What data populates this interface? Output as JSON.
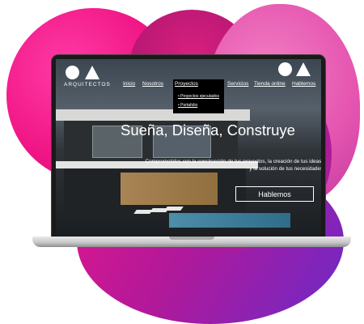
{
  "logo": {
    "text": "ARQUITECTOS",
    "icon": "oa-monogram-icon"
  },
  "nav": {
    "items": [
      {
        "label": "Inicio"
      },
      {
        "label": "Nosotros"
      },
      {
        "label": "Proyectos"
      },
      {
        "label": "Servicios"
      },
      {
        "label": "Tienda online"
      },
      {
        "label": "Hablemos"
      }
    ],
    "dropdown": [
      {
        "label": "Proyectos ejecutados"
      },
      {
        "label": "Portafolio"
      }
    ]
  },
  "hero": {
    "title": "Sueña, Diseña, Construye",
    "subtitle": "Comprometidos con la construcción de tus proyectos, la creación de tus ideas, y la solución de tus necesidades",
    "button_label": "Hablemos"
  },
  "colors": {
    "pink": "#f01585",
    "magenta": "#b31b8f",
    "purple": "#6c2ac8",
    "light_pink": "#e555b0"
  }
}
